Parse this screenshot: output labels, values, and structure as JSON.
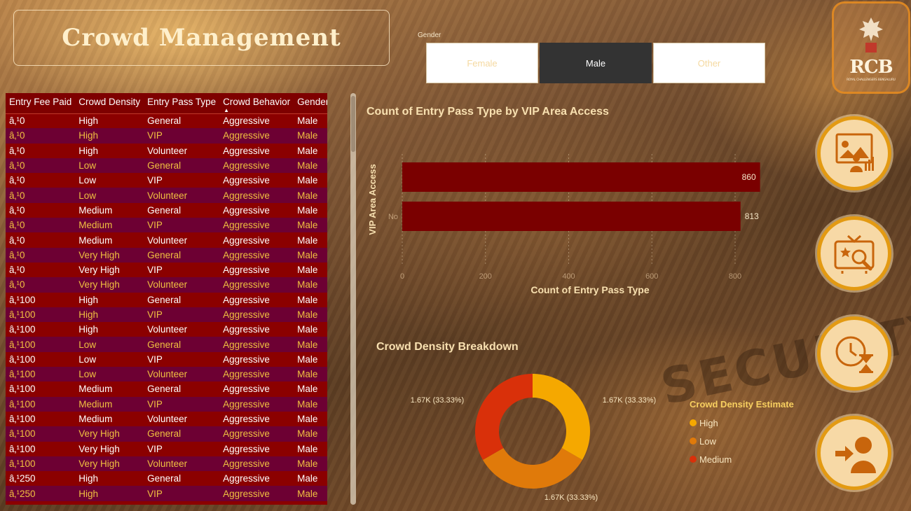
{
  "title": "Crowd Management",
  "background_text": "SECURITY",
  "gender_slicer": {
    "label": "Gender",
    "options": [
      "Female",
      "Male",
      "Other"
    ],
    "selected": "Male"
  },
  "logo": {
    "text": "RCB",
    "subtext": "ROYAL CHALLENGERS BENGALURU"
  },
  "table": {
    "columns": [
      "Entry Fee Paid",
      "Crowd Density",
      "Entry Pass Type",
      "Crowd Behavior",
      "Gender"
    ],
    "sorted_column": "Crowd Behavior",
    "rows": [
      [
        "â‚¹0",
        "High",
        "General",
        "Aggressive",
        "Male"
      ],
      [
        "â‚¹0",
        "High",
        "VIP",
        "Aggressive",
        "Male"
      ],
      [
        "â‚¹0",
        "High",
        "Volunteer",
        "Aggressive",
        "Male"
      ],
      [
        "â‚¹0",
        "Low",
        "General",
        "Aggressive",
        "Male"
      ],
      [
        "â‚¹0",
        "Low",
        "VIP",
        "Aggressive",
        "Male"
      ],
      [
        "â‚¹0",
        "Low",
        "Volunteer",
        "Aggressive",
        "Male"
      ],
      [
        "â‚¹0",
        "Medium",
        "General",
        "Aggressive",
        "Male"
      ],
      [
        "â‚¹0",
        "Medium",
        "VIP",
        "Aggressive",
        "Male"
      ],
      [
        "â‚¹0",
        "Medium",
        "Volunteer",
        "Aggressive",
        "Male"
      ],
      [
        "â‚¹0",
        "Very High",
        "General",
        "Aggressive",
        "Male"
      ],
      [
        "â‚¹0",
        "Very High",
        "VIP",
        "Aggressive",
        "Male"
      ],
      [
        "â‚¹0",
        "Very High",
        "Volunteer",
        "Aggressive",
        "Male"
      ],
      [
        "â‚¹100",
        "High",
        "General",
        "Aggressive",
        "Male"
      ],
      [
        "â‚¹100",
        "High",
        "VIP",
        "Aggressive",
        "Male"
      ],
      [
        "â‚¹100",
        "High",
        "Volunteer",
        "Aggressive",
        "Male"
      ],
      [
        "â‚¹100",
        "Low",
        "General",
        "Aggressive",
        "Male"
      ],
      [
        "â‚¹100",
        "Low",
        "VIP",
        "Aggressive",
        "Male"
      ],
      [
        "â‚¹100",
        "Low",
        "Volunteer",
        "Aggressive",
        "Male"
      ],
      [
        "â‚¹100",
        "Medium",
        "General",
        "Aggressive",
        "Male"
      ],
      [
        "â‚¹100",
        "Medium",
        "VIP",
        "Aggressive",
        "Male"
      ],
      [
        "â‚¹100",
        "Medium",
        "Volunteer",
        "Aggressive",
        "Male"
      ],
      [
        "â‚¹100",
        "Very High",
        "General",
        "Aggressive",
        "Male"
      ],
      [
        "â‚¹100",
        "Very High",
        "VIP",
        "Aggressive",
        "Male"
      ],
      [
        "â‚¹100",
        "Very High",
        "Volunteer",
        "Aggressive",
        "Male"
      ],
      [
        "â‚¹250",
        "High",
        "General",
        "Aggressive",
        "Male"
      ],
      [
        "â‚¹250",
        "High",
        "VIP",
        "Aggressive",
        "Male"
      ]
    ]
  },
  "chart_data": [
    {
      "type": "bar",
      "orientation": "horizontal",
      "title": "Count of Entry Pass Type by VIP Area Access",
      "xlabel": "Count of Entry Pass Type",
      "ylabel": "VIP Area Access",
      "categories": [
        "",
        "No"
      ],
      "values": [
        860,
        813
      ],
      "data_labels": [
        "860",
        "813"
      ],
      "xticks": [
        "0",
        "200",
        "400",
        "600",
        "800"
      ],
      "xlim": [
        0,
        900
      ],
      "bar_color": "#7a0000",
      "grid": true
    },
    {
      "type": "pie",
      "variant": "donut",
      "title": "Crowd Density Breakdown",
      "legend_title": "Crowd Density Estimate",
      "legend_position": "right",
      "categories": [
        "High",
        "Low",
        "Medium"
      ],
      "values": [
        33.33,
        33.33,
        33.33
      ],
      "data_labels": [
        "1.67K (33.33%)",
        "1.67K (33.33%)",
        "1.67K (33.33%)"
      ],
      "colors": [
        "#f5a800",
        "#e07a0a",
        "#d9300a"
      ]
    }
  ],
  "nav_buttons": [
    {
      "name": "dashboard-nav-button",
      "icon": "presentation-analytics-icon"
    },
    {
      "name": "tv-search-nav-button",
      "icon": "tv-search-icon"
    },
    {
      "name": "time-nav-button",
      "icon": "clock-hourglass-icon"
    },
    {
      "name": "exit-nav-button",
      "icon": "user-entry-icon"
    }
  ]
}
